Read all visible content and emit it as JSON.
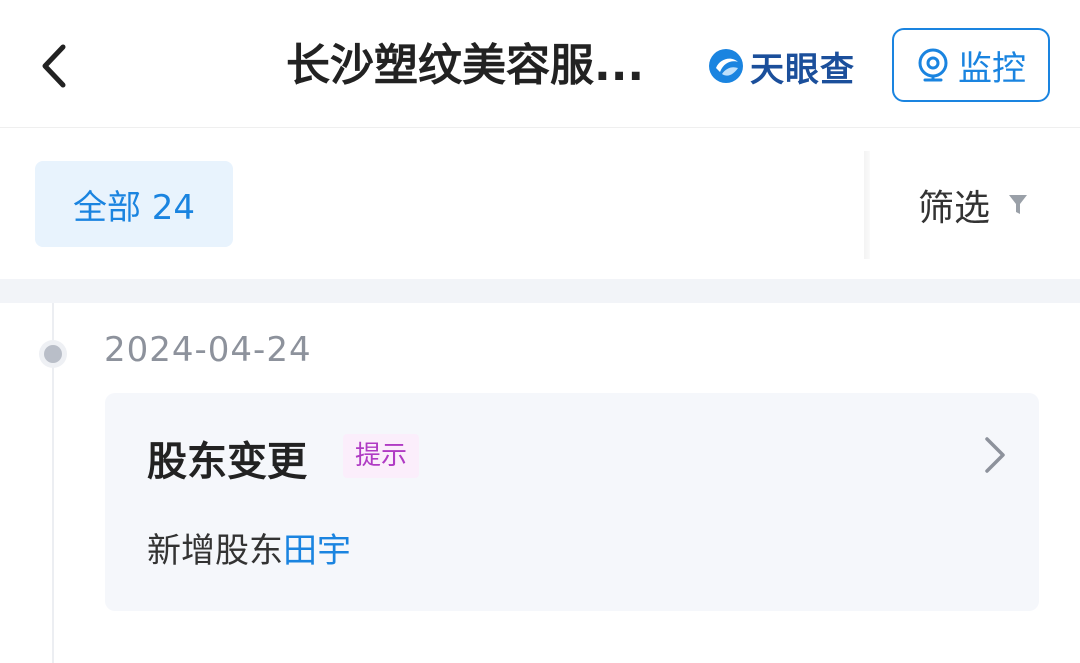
{
  "header": {
    "title": "长沙塑纹美容服...",
    "brand": "天眼查",
    "monitor_label": "监控"
  },
  "filters": {
    "all_tab": "全部 24",
    "filter_label": "筛选"
  },
  "timeline": {
    "entries": [
      {
        "date": "2024-04-24",
        "title": "股东变更",
        "badge": "提示",
        "detail_prefix": "新增股东",
        "detail_link": "田宇"
      }
    ]
  },
  "colors": {
    "accent": "#1a84e0",
    "badge_text": "#b03bc4",
    "badge_bg": "#fbeefb"
  },
  "icons": [
    "back-chevron-icon",
    "tianyancha-logo-icon",
    "monitor-eye-icon",
    "filter-funnel-icon",
    "chevron-right-icon"
  ]
}
